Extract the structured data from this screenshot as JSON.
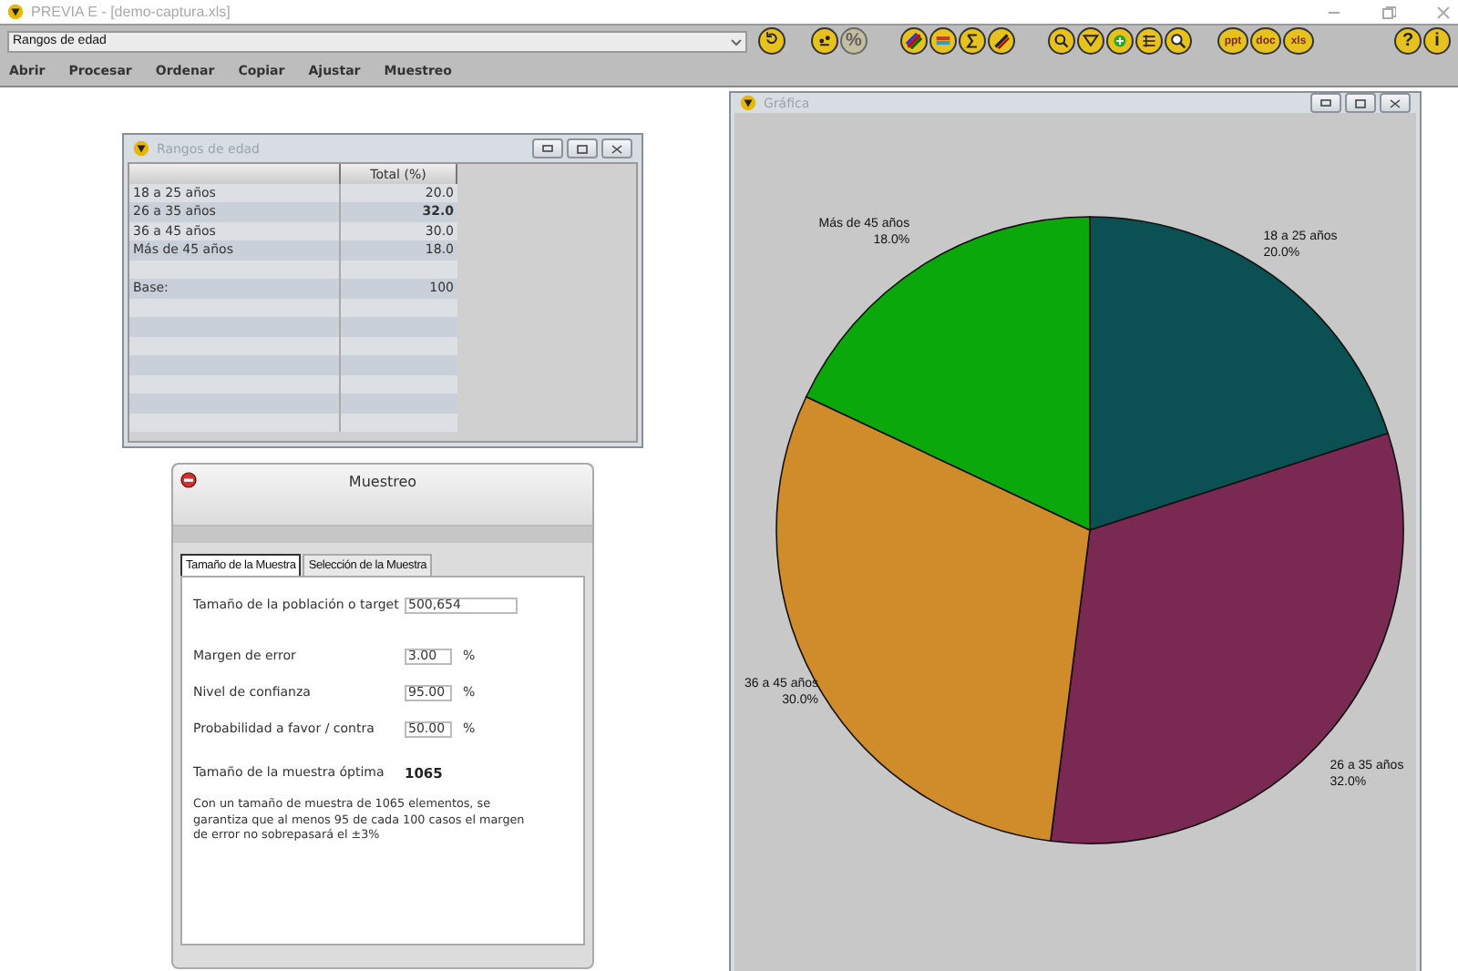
{
  "window": {
    "title": "PREVIA E - [demo-captura.xls]",
    "active": false
  },
  "selector": {
    "value": "Rangos de edad"
  },
  "toolbar": [
    [
      {
        "kind": "refresh",
        "disabled": false
      }
    ],
    [
      {
        "kind": "numbers",
        "disabled": false
      },
      {
        "kind": "percent",
        "label": "%",
        "disabled": true
      }
    ],
    [
      {
        "kind": "colors",
        "disabled": false
      },
      {
        "kind": "bars",
        "disabled": false
      },
      {
        "kind": "sigma",
        "disabled": false
      },
      {
        "kind": "stripes",
        "disabled": false
      }
    ],
    [
      {
        "kind": "search",
        "disabled": false
      },
      {
        "kind": "filter",
        "disabled": false
      },
      {
        "kind": "plus",
        "disabled": false
      },
      {
        "kind": "list",
        "disabled": false
      },
      {
        "kind": "zoom",
        "disabled": false
      }
    ],
    [
      {
        "kind": "file",
        "label": "ppt",
        "disabled": false
      },
      {
        "kind": "file",
        "label": "doc",
        "disabled": false
      },
      {
        "kind": "file",
        "label": "xls",
        "disabled": false
      }
    ],
    [
      {
        "kind": "help",
        "label": "?",
        "disabled": false
      },
      {
        "kind": "info",
        "label": "i",
        "disabled": false
      }
    ]
  ],
  "menu": [
    "Abrir",
    "Procesar",
    "Ordenar",
    "Copiar",
    "Ajustar",
    "Muestreo"
  ],
  "table_window": {
    "title": "Rangos de edad",
    "columns": [
      "Total (%)"
    ],
    "rows": [
      {
        "kind": "data",
        "label": "18 a 25 años",
        "value": "20.0",
        "bold": false
      },
      {
        "kind": "data",
        "label": "26 a 35 años",
        "value": "32.0",
        "bold": true
      },
      {
        "kind": "data",
        "label": "36 a 45 años",
        "value": "30.0",
        "bold": false
      },
      {
        "kind": "data",
        "label": "Más de 45 años",
        "value": "18.0",
        "bold": false
      },
      {
        "kind": "spacer"
      },
      {
        "kind": "data",
        "label": "Base:",
        "value": "100",
        "bold": false
      }
    ]
  },
  "sampling_window": {
    "title": "Muestreo",
    "tabs": [
      {
        "label": "Tamaño de la Muestra",
        "selected": true
      },
      {
        "label": "Selección de la Muestra",
        "selected": false
      }
    ],
    "fields": [
      {
        "label": "Tamaño de la población o target",
        "value": "500,654",
        "kind": "wide"
      },
      {
        "label": "Margen de error",
        "value": "3.00",
        "unit": "%",
        "kind": "short"
      },
      {
        "label": "Nivel de confianza",
        "value": "95.00",
        "unit": "%",
        "kind": "short"
      },
      {
        "label": "Probabilidad a favor / contra",
        "value": "50.00",
        "unit": "%",
        "kind": "short"
      }
    ],
    "result": {
      "label": "Tamaño de la muestra óptima",
      "value": "1065"
    },
    "note": "Con un tamaño de muestra de 1065 elementos, se garantiza que al menos 95 de cada 100 casos el margen de error no sobrepasará el ±3%"
  },
  "chart_window": {
    "title": "Gráfica",
    "chart_data": {
      "type": "pie",
      "categories": [
        "18 a 25 años",
        "26 a 35 años",
        "36 a 45 años",
        "Más de 45 años"
      ],
      "values": [
        20,
        32,
        30,
        18
      ],
      "colors": [
        "#0b5052",
        "#7a2a52",
        "#d08b2b",
        "#0aa80a"
      ],
      "value_labels": [
        "20.0%",
        "32.0%",
        "30.0%",
        "18.0%"
      ]
    }
  }
}
